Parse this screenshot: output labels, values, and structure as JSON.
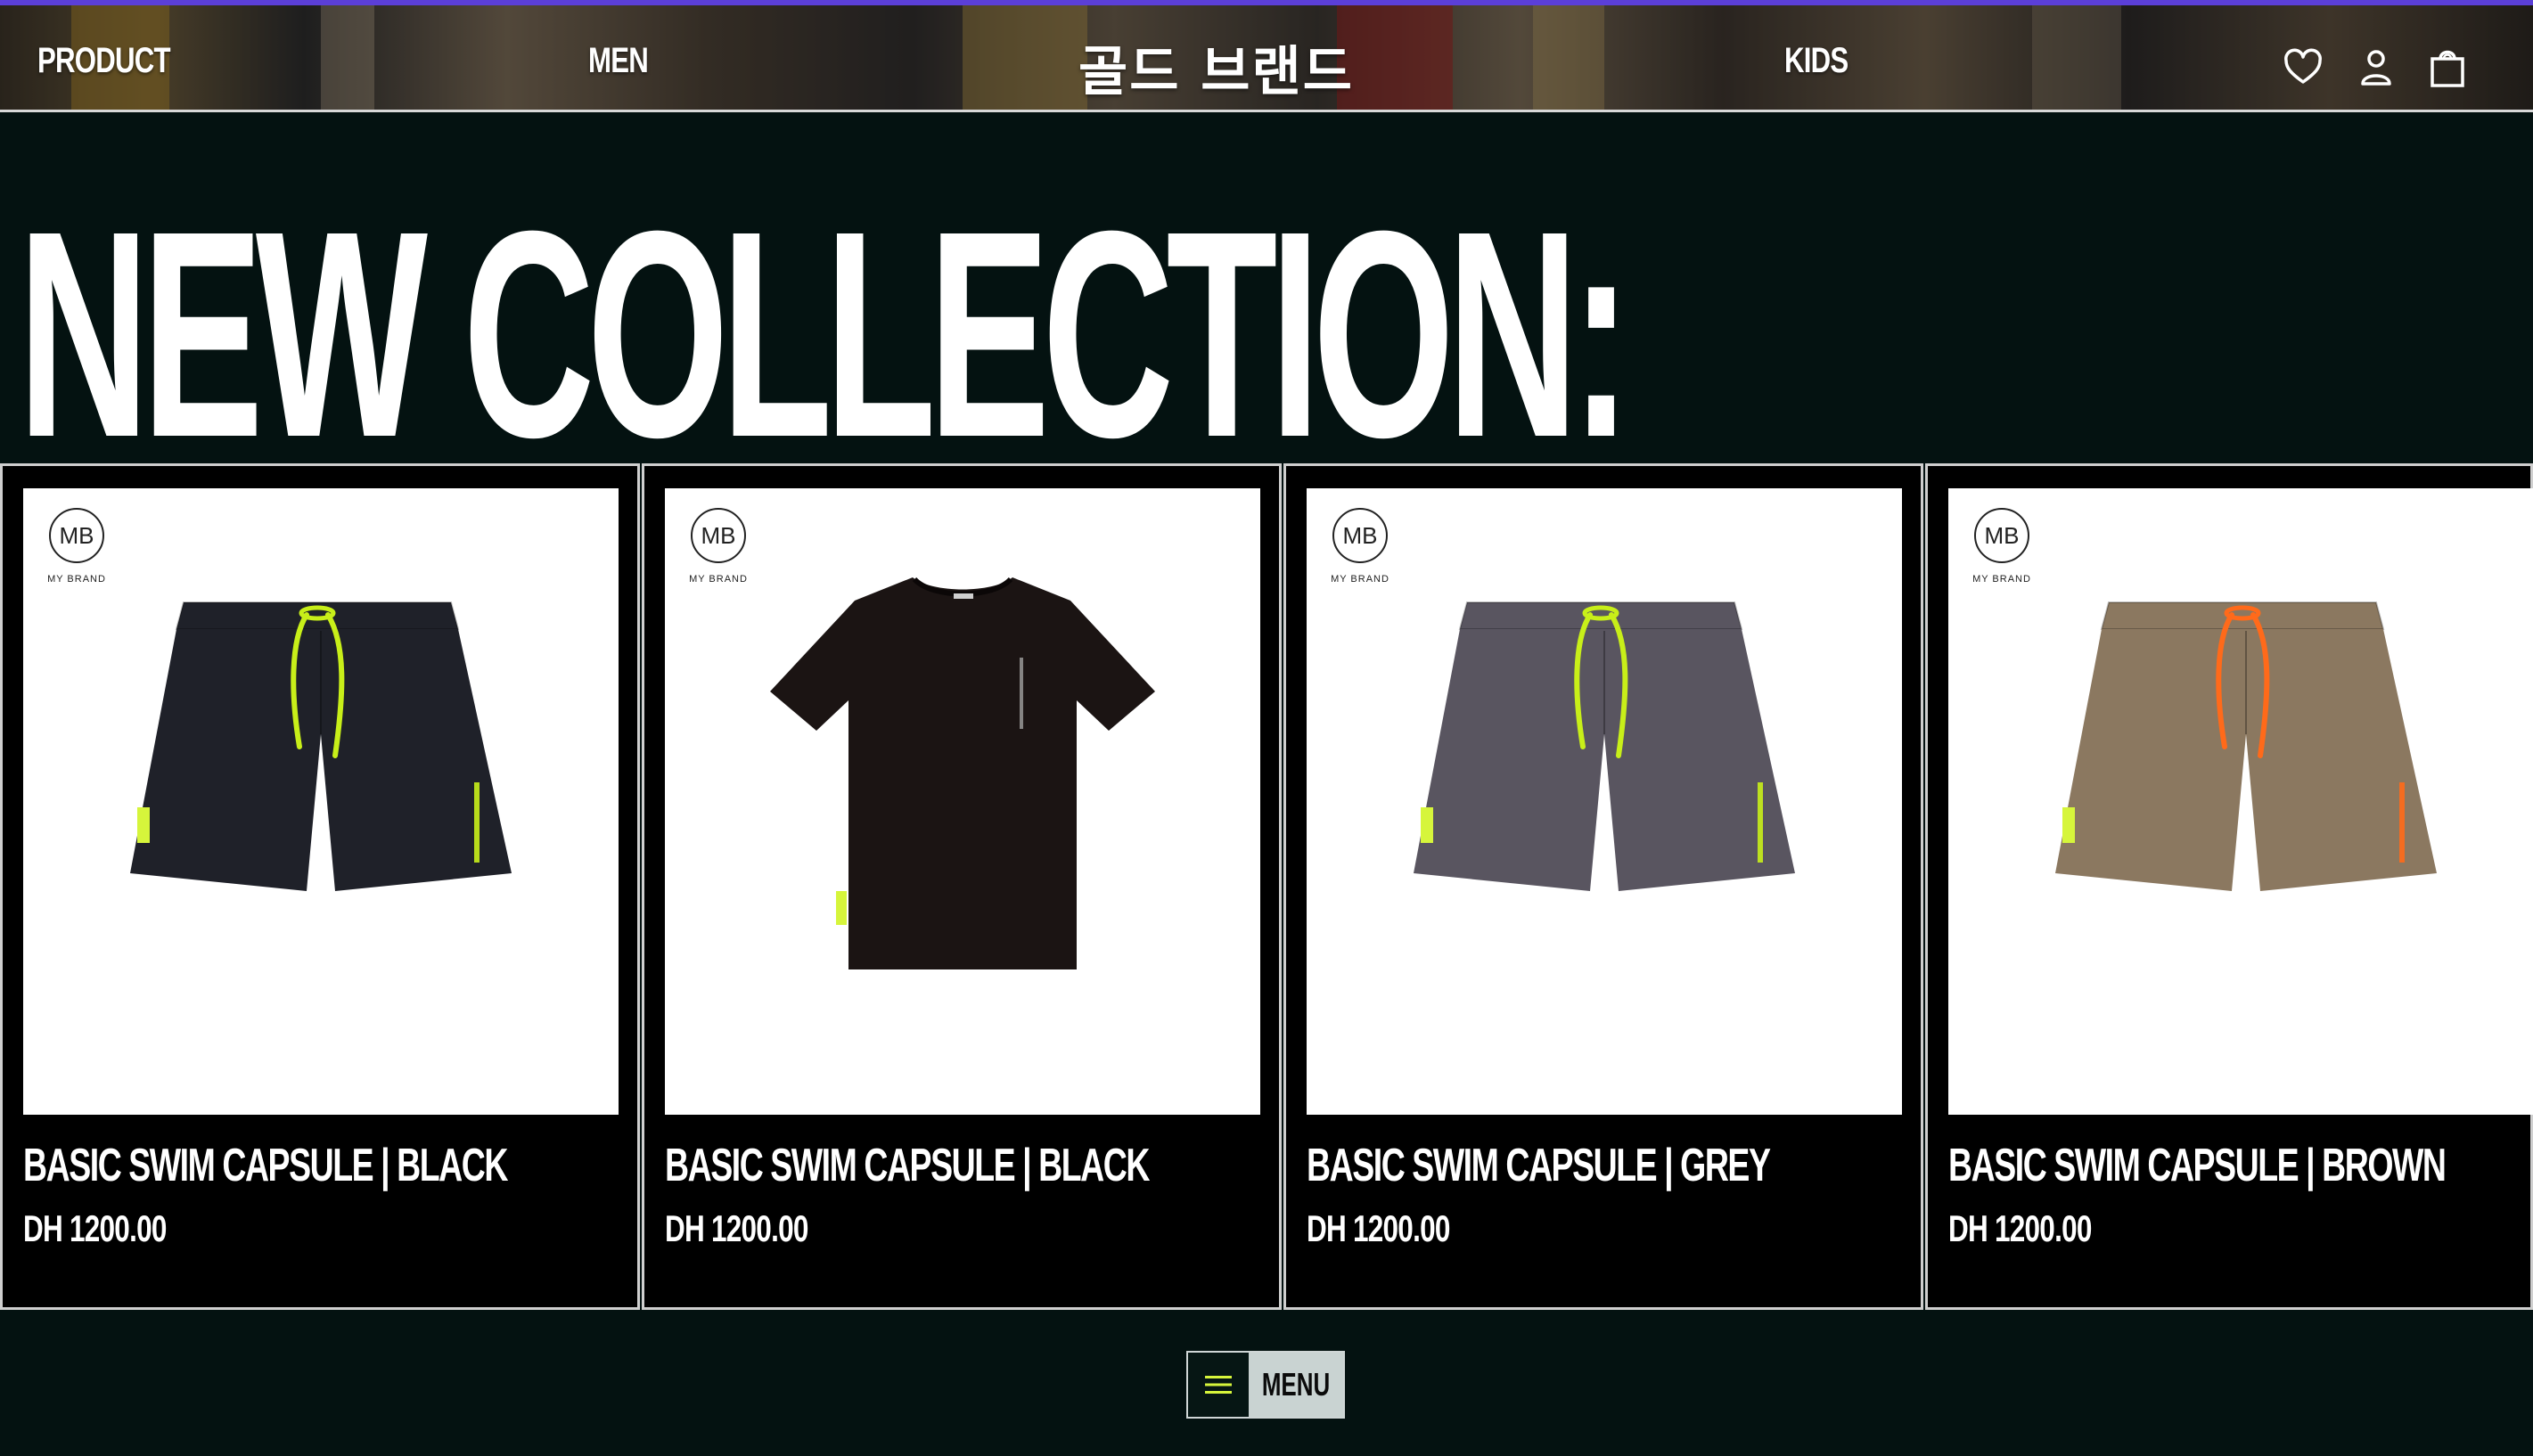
{
  "header": {
    "nav": [
      {
        "label": "PRODUCT"
      },
      {
        "label": "MEN"
      },
      {
        "label": "KIDS"
      }
    ],
    "brand": "골드 브랜드",
    "icons": [
      "heart-icon",
      "user-icon",
      "shopping-bag-icon"
    ]
  },
  "main": {
    "title": "NEW COLLECTION:",
    "products": [
      {
        "name": "BASIC SWIM CAPSULE | BLACK",
        "price": "DH 1200.00",
        "kind": "shorts",
        "color": "#1f2129",
        "cord": "#c8ef19",
        "tag": "#d6f53b",
        "logo_text": "MY BRAND"
      },
      {
        "name": "BASIC SWIM CAPSULE | BLACK",
        "price": "DH 1200.00",
        "kind": "tshirt",
        "color": "#1b1413",
        "cord": "#c8ef19",
        "tag": "#d6f53b",
        "logo_text": "MY BRAND"
      },
      {
        "name": "BASIC SWIM CAPSULE | GREY",
        "price": "DH 1200.00",
        "kind": "shorts",
        "color": "#595560",
        "cord": "#c8ef19",
        "tag": "#d6f53b",
        "logo_text": "MY BRAND"
      },
      {
        "name": "BASIC SWIM CAPSULE | BROWN",
        "price": "DH 1200.00",
        "kind": "shorts",
        "color": "#8b7860",
        "cord": "#ff6a1a",
        "tag": "#d6f53b",
        "logo_text": "MY BRAND"
      }
    ]
  },
  "footer": {
    "menu_label": "MENU",
    "menu_icon": "hamburger-icon"
  },
  "colors": {
    "background": "#041211",
    "accent": "#5b3fd8",
    "card_bg": "#000000",
    "menu_label_bg": "#c9d3d2"
  }
}
